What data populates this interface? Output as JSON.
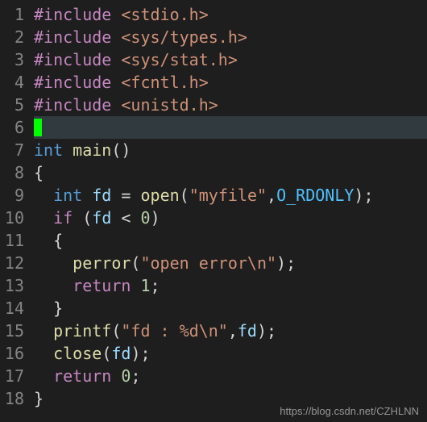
{
  "lines": [
    {
      "n": 1,
      "tokens": [
        {
          "cls": "kw-preproc",
          "t": "#include"
        },
        {
          "cls": "punct",
          "t": " "
        },
        {
          "cls": "hdr",
          "t": "<stdio.h>"
        }
      ]
    },
    {
      "n": 2,
      "tokens": [
        {
          "cls": "kw-preproc",
          "t": "#include"
        },
        {
          "cls": "punct",
          "t": " "
        },
        {
          "cls": "hdr",
          "t": "<sys/types.h>"
        }
      ]
    },
    {
      "n": 3,
      "tokens": [
        {
          "cls": "kw-preproc",
          "t": "#include"
        },
        {
          "cls": "punct",
          "t": " "
        },
        {
          "cls": "hdr",
          "t": "<sys/stat.h>"
        }
      ]
    },
    {
      "n": 4,
      "tokens": [
        {
          "cls": "kw-preproc",
          "t": "#include"
        },
        {
          "cls": "punct",
          "t": " "
        },
        {
          "cls": "hdr",
          "t": "<fcntl.h>"
        }
      ]
    },
    {
      "n": 5,
      "tokens": [
        {
          "cls": "kw-preproc",
          "t": "#include"
        },
        {
          "cls": "punct",
          "t": " "
        },
        {
          "cls": "hdr",
          "t": "<unistd.h>"
        }
      ]
    },
    {
      "n": 6,
      "current": true,
      "cursor": true,
      "tokens": []
    },
    {
      "n": 7,
      "tokens": [
        {
          "cls": "kw-type",
          "t": "int"
        },
        {
          "cls": "punct",
          "t": " "
        },
        {
          "cls": "fn",
          "t": "main"
        },
        {
          "cls": "punct",
          "t": "()"
        }
      ]
    },
    {
      "n": 8,
      "tokens": [
        {
          "cls": "punct",
          "t": "{"
        }
      ]
    },
    {
      "n": 9,
      "tokens": [
        {
          "cls": "punct",
          "t": "  "
        },
        {
          "cls": "kw-type",
          "t": "int"
        },
        {
          "cls": "punct",
          "t": " "
        },
        {
          "cls": "var",
          "t": "fd"
        },
        {
          "cls": "punct",
          "t": " "
        },
        {
          "cls": "op",
          "t": "="
        },
        {
          "cls": "punct",
          "t": " "
        },
        {
          "cls": "fn",
          "t": "open"
        },
        {
          "cls": "punct",
          "t": "("
        },
        {
          "cls": "str",
          "t": "\"myfile\""
        },
        {
          "cls": "punct",
          "t": ","
        },
        {
          "cls": "const",
          "t": "O_RDONLY"
        },
        {
          "cls": "punct",
          "t": ");"
        }
      ]
    },
    {
      "n": 10,
      "tokens": [
        {
          "cls": "punct",
          "t": "  "
        },
        {
          "cls": "kw-ctrl",
          "t": "if"
        },
        {
          "cls": "punct",
          "t": " ("
        },
        {
          "cls": "var",
          "t": "fd"
        },
        {
          "cls": "punct",
          "t": " "
        },
        {
          "cls": "op",
          "t": "<"
        },
        {
          "cls": "punct",
          "t": " "
        },
        {
          "cls": "num",
          "t": "0"
        },
        {
          "cls": "punct",
          "t": ")"
        }
      ]
    },
    {
      "n": 11,
      "tokens": [
        {
          "cls": "punct",
          "t": "  {"
        }
      ]
    },
    {
      "n": 12,
      "tokens": [
        {
          "cls": "punct",
          "t": "    "
        },
        {
          "cls": "fn",
          "t": "perror"
        },
        {
          "cls": "punct",
          "t": "("
        },
        {
          "cls": "str",
          "t": "\"open error\\n\""
        },
        {
          "cls": "punct",
          "t": ");"
        }
      ]
    },
    {
      "n": 13,
      "tokens": [
        {
          "cls": "punct",
          "t": "    "
        },
        {
          "cls": "kw-ctrl",
          "t": "return"
        },
        {
          "cls": "punct",
          "t": " "
        },
        {
          "cls": "num",
          "t": "1"
        },
        {
          "cls": "punct",
          "t": ";"
        }
      ]
    },
    {
      "n": 14,
      "tokens": [
        {
          "cls": "punct",
          "t": "  }"
        }
      ]
    },
    {
      "n": 15,
      "tokens": [
        {
          "cls": "punct",
          "t": "  "
        },
        {
          "cls": "fn",
          "t": "printf"
        },
        {
          "cls": "punct",
          "t": "("
        },
        {
          "cls": "str",
          "t": "\"fd : %d\\n\""
        },
        {
          "cls": "punct",
          "t": ","
        },
        {
          "cls": "var",
          "t": "fd"
        },
        {
          "cls": "punct",
          "t": ");"
        }
      ]
    },
    {
      "n": 16,
      "tokens": [
        {
          "cls": "punct",
          "t": "  "
        },
        {
          "cls": "fn",
          "t": "close"
        },
        {
          "cls": "punct",
          "t": "("
        },
        {
          "cls": "var",
          "t": "fd"
        },
        {
          "cls": "punct",
          "t": ");"
        }
      ]
    },
    {
      "n": 17,
      "tokens": [
        {
          "cls": "punct",
          "t": "  "
        },
        {
          "cls": "kw-ctrl",
          "t": "return"
        },
        {
          "cls": "punct",
          "t": " "
        },
        {
          "cls": "num",
          "t": "0"
        },
        {
          "cls": "punct",
          "t": ";"
        }
      ]
    },
    {
      "n": 18,
      "tokens": [
        {
          "cls": "punct",
          "t": "}"
        }
      ]
    }
  ],
  "watermark": "https://blog.csdn.net/CZHLNN"
}
